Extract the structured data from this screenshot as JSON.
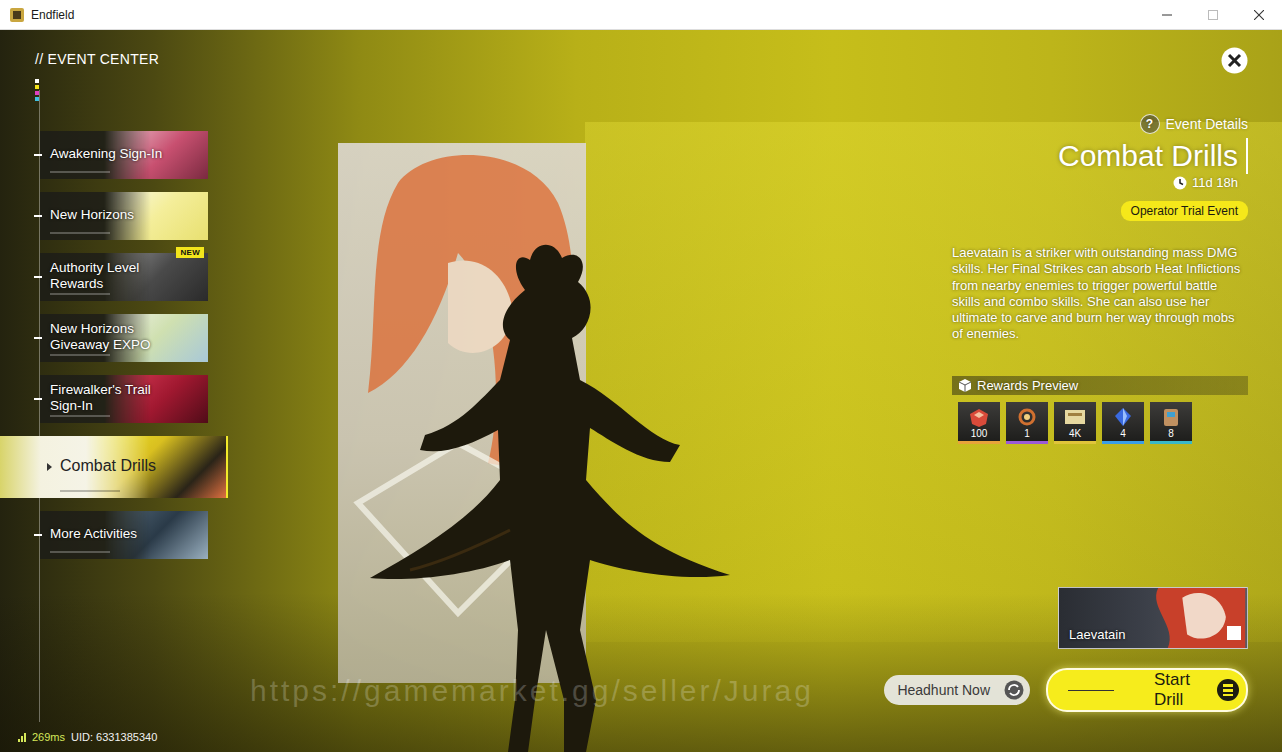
{
  "window": {
    "title": "Endfield"
  },
  "header": {
    "title": "// EVENT CENTER"
  },
  "sidebar": {
    "items": [
      {
        "label": "Awakening Sign-In",
        "selected": false
      },
      {
        "label": "New Horizons",
        "selected": false
      },
      {
        "label": "Authority Level Rewards",
        "selected": false,
        "badge": "NEW"
      },
      {
        "label": "New Horizons Giveaway EXPO",
        "selected": false
      },
      {
        "label": "Firewalker's Trail Sign-In",
        "selected": false
      },
      {
        "label": "Combat Drills",
        "selected": true
      },
      {
        "label": "More Activities",
        "selected": false
      }
    ]
  },
  "status_bar": {
    "ping": "269ms",
    "uid": "UID: 6331385340"
  },
  "event": {
    "details_label": "Event Details",
    "help_icon": "?",
    "title": "Combat Drills",
    "timer": "11d 18h",
    "tag": "Operator Trial Event",
    "description": "Laevatain is a striker with outstanding mass DMG skills. Her Final Strikes can absorb Heat Inflictions from nearby enemies to trigger powerful battle skills and combo skills. She can also use her ultimate to carve and burn her way through mobs of enemies.",
    "rewards_label": "Rewards Preview",
    "rewards": [
      {
        "count": "100",
        "color": "#e8a33a"
      },
      {
        "count": "1",
        "color": "#9b5bd6"
      },
      {
        "count": "4K",
        "color": "#e0c43a"
      },
      {
        "count": "4",
        "color": "#3a9ee8"
      },
      {
        "count": "8",
        "color": "#3ab8c8"
      }
    ]
  },
  "operator": {
    "name": "Laevatain"
  },
  "buttons": [
    {
      "label": "Headhunt Now",
      "kind": "secondary"
    },
    {
      "label": "Start Drill",
      "kind": "primary"
    }
  ],
  "watermark": "https://gamemarket.gg/seller/Jurag"
}
